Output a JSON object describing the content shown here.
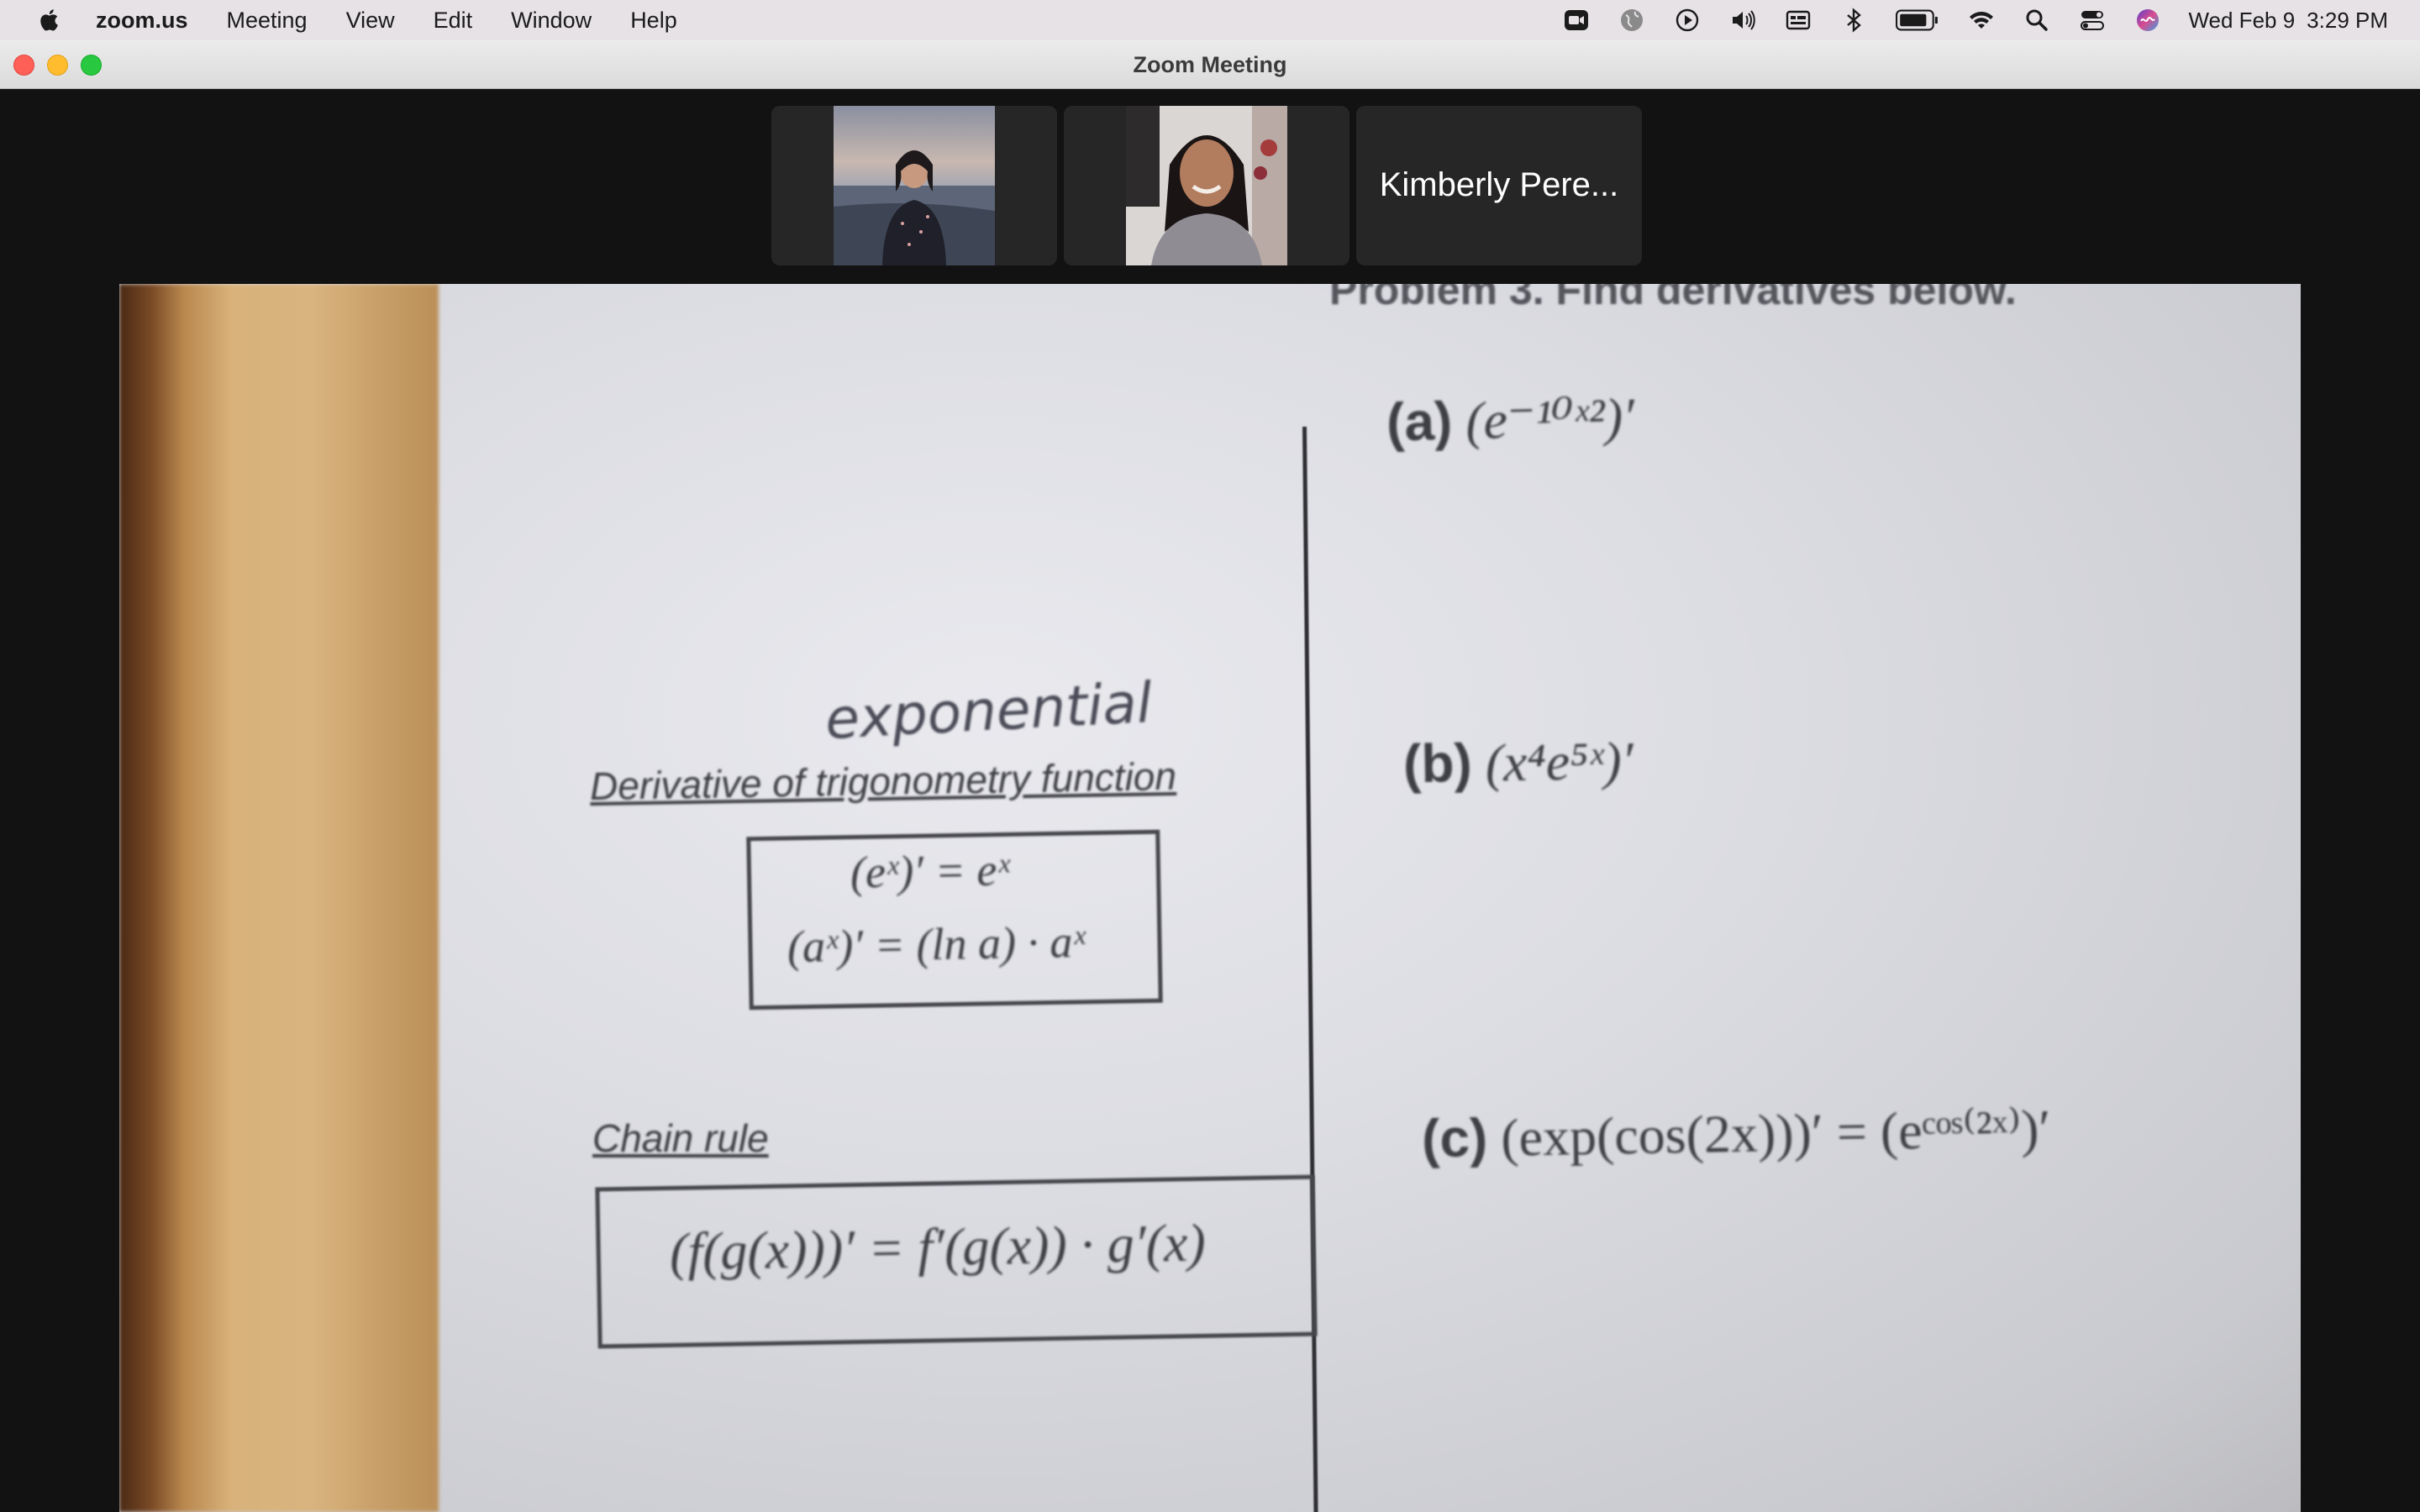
{
  "menubar": {
    "app_name": "zoom.us",
    "items": [
      "Meeting",
      "View",
      "Edit",
      "Window",
      "Help"
    ],
    "date": "Wed Feb 9",
    "time": "3:29 PM",
    "status_icons": [
      "zoom-camera-icon",
      "vpn-globe-icon",
      "play-icon",
      "volume-icon",
      "keyboard-input-icon",
      "bluetooth-icon",
      "battery-icon",
      "wifi-icon",
      "spotlight-search-icon",
      "control-center-icon",
      "siri-icon"
    ]
  },
  "window": {
    "title": "Zoom Meeting"
  },
  "participants": [
    {
      "kind": "video",
      "icon": "participant-video-1"
    },
    {
      "kind": "video",
      "icon": "participant-video-2"
    },
    {
      "kind": "name",
      "name": "Kimberly Pere..."
    }
  ],
  "shared_content": {
    "header_partial": "Problem 3. Find derivatives below.",
    "handwritten": "exponential",
    "section1_title": "Derivative of trigonometry function",
    "rule1": "(eˣ)′ = eˣ",
    "rule2": "(aˣ)′ = (ln a) · aˣ",
    "section2_title": "Chain rule",
    "chain_rule": "(f(g(x)))′ = f′(g(x)) · g′(x)",
    "problem_a_label": "(a)",
    "problem_a": "(e⁻¹⁰ˣ²)′",
    "problem_b_label": "(b)",
    "problem_b": "(x⁴e⁵ˣ)′",
    "problem_c_label": "(c)",
    "problem_c": "(exp(cos(2x)))′ = (eᶜᵒˢ⁽²ˣ⁾)′"
  },
  "colors": {
    "menubar_bg": "#e6e2e6",
    "stage_bg": "#121212",
    "tile_bg": "#262626",
    "close": "#fe5f57",
    "minimize": "#febc2e",
    "maximize": "#28c840"
  }
}
